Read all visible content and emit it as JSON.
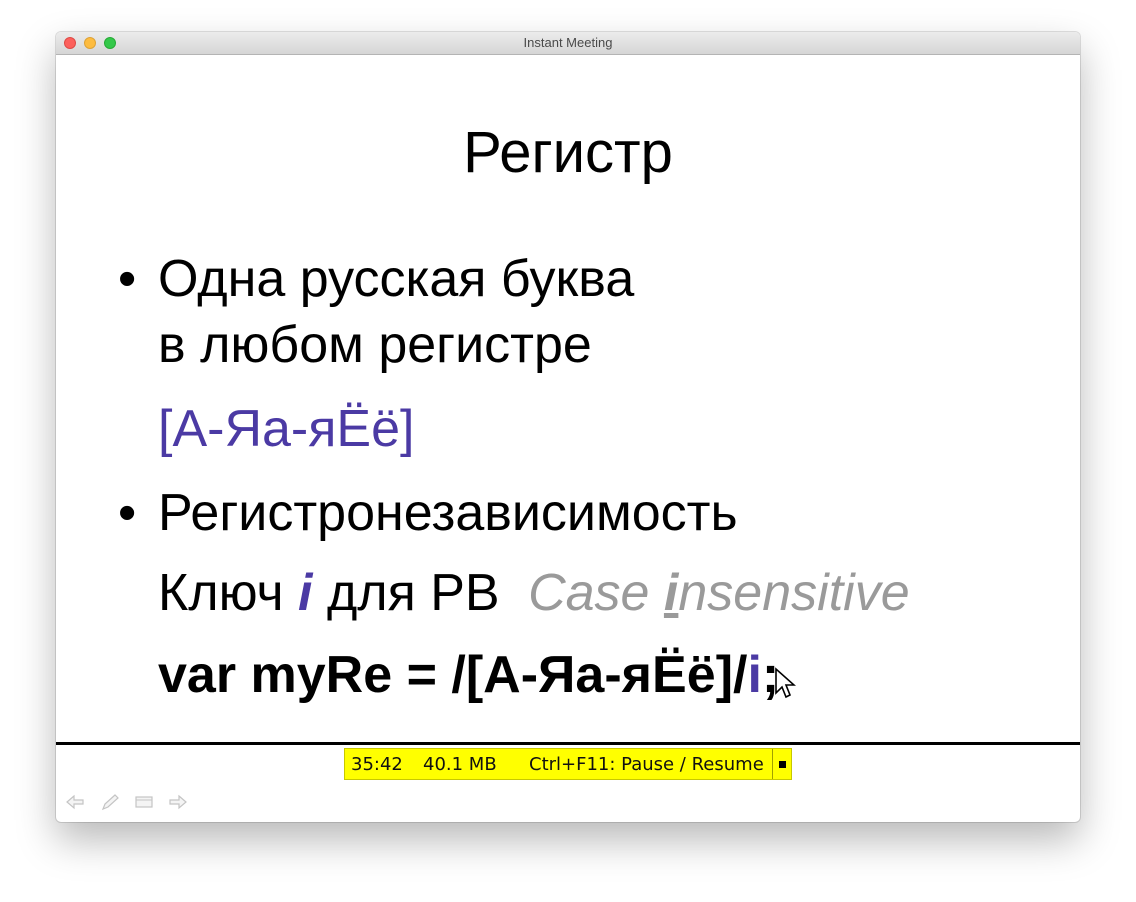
{
  "window": {
    "title": "Instant Meeting"
  },
  "slide": {
    "title": "Регистр",
    "bullet1": {
      "line1": "Одна русская буква",
      "line2": "в любом регистре",
      "pattern": "[А-Яа-яЁё]"
    },
    "bullet2": {
      "heading": "Регистронезависимость",
      "key_prefix": "Ключ",
      "key_letter": "i",
      "key_suffix": "для РВ",
      "case_c": "Case",
      "case_i": "i",
      "case_rest": "nsensitive",
      "code_prefix": "var myRe = /[А-Яа-яЁё]/",
      "code_flag": "i",
      "code_end": ";"
    }
  },
  "status": {
    "time": "35:42",
    "memory": "40.1 MB",
    "hint": "Ctrl+F11: Pause / Resume"
  },
  "nav_icons": [
    "back-arrow-icon",
    "pen-icon",
    "slides-icon",
    "forward-arrow-icon"
  ]
}
